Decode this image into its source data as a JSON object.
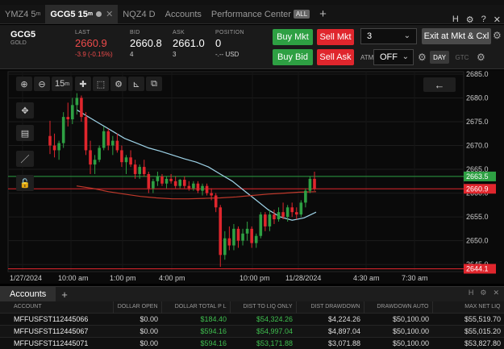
{
  "tabs": [
    {
      "label": "YMZ4 5",
      "sup": "m",
      "active": false
    },
    {
      "label": "GCG5 15",
      "sup": "m",
      "active": true
    },
    {
      "label": "NQZ4 D",
      "active": false
    },
    {
      "label": "Accounts",
      "active": false
    },
    {
      "label": "Performance Center",
      "badge": "ALL",
      "active": false
    }
  ],
  "window_controls": [
    "H",
    "⚙",
    "?",
    "✕"
  ],
  "quote": {
    "symbol": "GCG5",
    "symbol_desc": "GOLD",
    "last_label": "LAST",
    "last_value": "2660.9",
    "last_change": "-3.9 (-0.15%)",
    "bid_label": "BID",
    "bid_value": "2660.8",
    "bid_size": "4",
    "ask_label": "ASK",
    "ask_value": "2661.0",
    "ask_size": "3",
    "position_label": "POSITION",
    "position_value": "0",
    "position_sub": "-.-- USD"
  },
  "order": {
    "buy_mkt": "Buy Mkt",
    "sell_mkt": "Sell Mkt",
    "buy_bid": "Buy Bid",
    "sell_ask": "Sell Ask",
    "quantity": "3",
    "exit_label": "Exit at Mkt & Cxl",
    "atm_label": "ATM",
    "atm_value": "OFF",
    "day_label": "DAY",
    "gtc_label": "GTC"
  },
  "chart_toolbar": {
    "interval": "15",
    "interval_sup": "m"
  },
  "chart_data": {
    "type": "candlestick",
    "y_ticks": [
      2645.0,
      2650.0,
      2655.0,
      2660.0,
      2665.0,
      2670.0,
      2675.0,
      2680.0,
      2685.0
    ],
    "ylim": [
      2643.5,
      2685.5
    ],
    "x_labels": [
      "1/27/2024",
      "10:00 am",
      "1:00 pm",
      "4:00 pm",
      "10:00 pm",
      "11/28/2024",
      "4:30 am",
      "7:30 am"
    ],
    "price_tags": [
      {
        "value": 2663.5,
        "label": "2663.5",
        "color": "#2ea043"
      },
      {
        "value": 2660.9,
        "label": "2660.9",
        "color": "#e0262d"
      },
      {
        "value": 2644.1,
        "label": "2644.1",
        "color": "#e0262d"
      }
    ],
    "candles": [
      [
        2672.0,
        2675.2,
        2668.2,
        2670.0
      ],
      [
        2670.0,
        2672.5,
        2667.5,
        2669.0
      ],
      [
        2669.0,
        2671.0,
        2667.0,
        2670.5
      ],
      [
        2670.5,
        2677.0,
        2669.5,
        2676.0
      ],
      [
        2676.0,
        2679.0,
        2674.0,
        2675.5
      ],
      [
        2675.5,
        2680.0,
        2674.5,
        2678.5
      ],
      [
        2678.5,
        2681.0,
        2676.5,
        2680.0
      ],
      [
        2680.0,
        2680.5,
        2675.0,
        2676.0
      ],
      [
        2676.0,
        2677.0,
        2668.0,
        2669.0
      ],
      [
        2669.0,
        2671.0,
        2664.0,
        2666.0
      ],
      [
        2666.0,
        2668.0,
        2664.0,
        2667.0
      ],
      [
        2667.0,
        2670.0,
        2666.5,
        2669.5
      ],
      [
        2669.5,
        2674.0,
        2669.0,
        2673.0
      ],
      [
        2673.0,
        2673.5,
        2669.0,
        2670.0
      ],
      [
        2670.0,
        2672.0,
        2668.0,
        2671.0
      ],
      [
        2671.0,
        2672.5,
        2668.5,
        2669.0
      ],
      [
        2669.0,
        2670.0,
        2665.5,
        2666.5
      ],
      [
        2666.5,
        2668.0,
        2664.0,
        2667.5
      ],
      [
        2667.5,
        2669.0,
        2665.5,
        2666.0
      ],
      [
        2666.0,
        2667.0,
        2663.0,
        2664.0
      ],
      [
        2664.0,
        2666.0,
        2663.0,
        2665.5
      ],
      [
        2665.5,
        2667.0,
        2663.5,
        2664.0
      ],
      [
        2664.0,
        2664.5,
        2660.0,
        2661.0
      ],
      [
        2661.0,
        2663.0,
        2660.0,
        2662.5
      ],
      [
        2662.5,
        2664.5,
        2661.5,
        2663.5
      ],
      [
        2663.5,
        2664.0,
        2661.5,
        2662.0
      ],
      [
        2662.0,
        2663.5,
        2661.0,
        2663.0
      ],
      [
        2663.0,
        2664.0,
        2662.0,
        2662.5
      ],
      [
        2662.5,
        2663.5,
        2661.0,
        2661.5
      ],
      [
        2661.5,
        2663.0,
        2661.0,
        2662.8
      ],
      [
        2662.8,
        2663.5,
        2661.0,
        2661.5
      ],
      [
        2661.5,
        2662.5,
        2660.5,
        2661.0
      ],
      [
        2661.0,
        2662.5,
        2660.5,
        2662.0
      ],
      [
        2662.0,
        2662.5,
        2660.0,
        2660.5
      ],
      [
        2660.5,
        2662.0,
        2659.5,
        2661.5
      ],
      [
        2661.5,
        2662.0,
        2659.5,
        2660.0
      ],
      [
        2660.0,
        2661.0,
        2658.5,
        2659.5
      ],
      [
        2659.5,
        2660.0,
        2656.0,
        2657.0
      ],
      [
        2657.0,
        2657.5,
        2644.5,
        2647.0
      ],
      [
        2647.0,
        2652.0,
        2646.0,
        2650.5
      ],
      [
        2650.5,
        2653.0,
        2648.0,
        2649.0
      ],
      [
        2649.0,
        2653.5,
        2648.0,
        2652.5
      ],
      [
        2652.5,
        2653.0,
        2648.5,
        2650.0
      ],
      [
        2650.0,
        2652.5,
        2649.0,
        2651.5
      ],
      [
        2651.5,
        2654.0,
        2650.0,
        2652.5
      ],
      [
        2652.5,
        2653.0,
        2648.5,
        2649.5
      ],
      [
        2649.5,
        2651.5,
        2648.5,
        2651.0
      ],
      [
        2651.0,
        2656.0,
        2650.5,
        2655.5
      ],
      [
        2655.5,
        2656.0,
        2652.0,
        2653.0
      ],
      [
        2653.0,
        2656.5,
        2652.0,
        2655.5
      ],
      [
        2655.5,
        2656.5,
        2653.5,
        2654.5
      ],
      [
        2654.5,
        2657.0,
        2654.0,
        2656.0
      ],
      [
        2656.0,
        2658.0,
        2654.5,
        2655.0
      ],
      [
        2655.0,
        2657.5,
        2654.0,
        2657.0
      ],
      [
        2657.0,
        2658.0,
        2655.0,
        2656.0
      ],
      [
        2656.0,
        2657.0,
        2654.5,
        2655.5
      ],
      [
        2655.5,
        2658.5,
        2655.0,
        2658.0
      ],
      [
        2658.0,
        2661.0,
        2657.0,
        2660.5
      ],
      [
        2660.5,
        2663.5,
        2660.0,
        2663.0
      ],
      [
        2663.0,
        2664.5,
        2660.5,
        2660.9
      ]
    ],
    "line_series": [
      {
        "color": "#9ed3e8",
        "values": [
          2677.5,
          2676.0,
          2674.5,
          2673.0,
          2671.5,
          2670.5,
          2669.5,
          2668.8,
          2668.0,
          2667.2,
          2666.5,
          2665.5,
          2664.0,
          2662.5,
          2660.5,
          2658.5,
          2656.5,
          2655.0,
          2654.3,
          2654.8,
          2656.0
        ]
      },
      {
        "color": "#c0392b",
        "values": [
          2661.5,
          2661.0,
          2660.3,
          2659.8,
          2659.3,
          2659.0,
          2658.8,
          2658.8,
          2658.9,
          2659.0,
          2659.2,
          2659.5,
          2659.8,
          2660.0,
          2660.2,
          2660.3
        ]
      }
    ]
  },
  "accounts": {
    "tab": "Accounts",
    "controls": [
      "H",
      "⚙",
      "✕"
    ],
    "columns": [
      "ACCOUNT",
      "DOLLAR OPEN",
      "DOLLAR TOTAL P L",
      "DIST TO LIQ ONLY",
      "DIST DRAWDOWN",
      "DRAWDOWN AUTO",
      "MAX NET LIQ"
    ],
    "rows": [
      [
        "MFFUSFST112445066",
        "$0.00",
        "$184.40",
        "$54,324.26",
        "$4,224.26",
        "$50,100.00",
        "$55,519.70"
      ],
      [
        "MFFUSFST112445067",
        "$0.00",
        "$594.16",
        "$54,997.04",
        "$4,897.04",
        "$50,100.00",
        "$55,015.20"
      ],
      [
        "MFFUSFST112445071",
        "$0.00",
        "$594.16",
        "$53,171.88",
        "$3,071.88",
        "$50,100.00",
        "$53,827.80"
      ]
    ]
  }
}
